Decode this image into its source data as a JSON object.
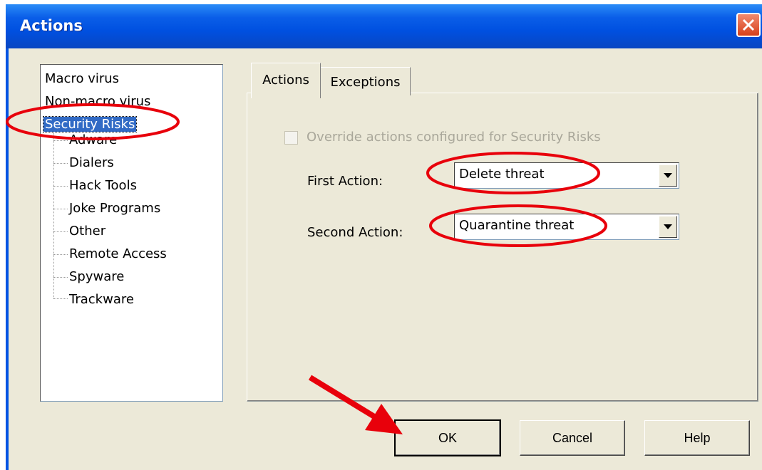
{
  "window": {
    "title": "Actions"
  },
  "tree": {
    "items": [
      {
        "label": "Macro virus"
      },
      {
        "label": "Non-macro virus"
      },
      {
        "label": "Security Risks",
        "selected": true
      },
      {
        "label": "Adware"
      },
      {
        "label": "Dialers"
      },
      {
        "label": "Hack Tools"
      },
      {
        "label": "Joke Programs"
      },
      {
        "label": "Other"
      },
      {
        "label": "Remote Access"
      },
      {
        "label": "Spyware"
      },
      {
        "label": "Trackware"
      }
    ]
  },
  "tabs": [
    {
      "label": "Actions",
      "active": true
    },
    {
      "label": "Exceptions",
      "active": false
    }
  ],
  "actions_panel": {
    "override_label": "Override actions configured for Security Risks",
    "override_checked": false,
    "override_enabled": false,
    "first_action_label": "First Action:",
    "first_action_value": "Delete threat",
    "second_action_label": "Second Action:",
    "second_action_value": "Quarantine threat"
  },
  "buttons": {
    "ok": "OK",
    "cancel": "Cancel",
    "help": "Help"
  },
  "annotation_color": "#e8000b",
  "icons": {
    "close": "close-icon",
    "dropdown": "chevron-down-icon",
    "annotation_arrow": "arrow-icon"
  }
}
